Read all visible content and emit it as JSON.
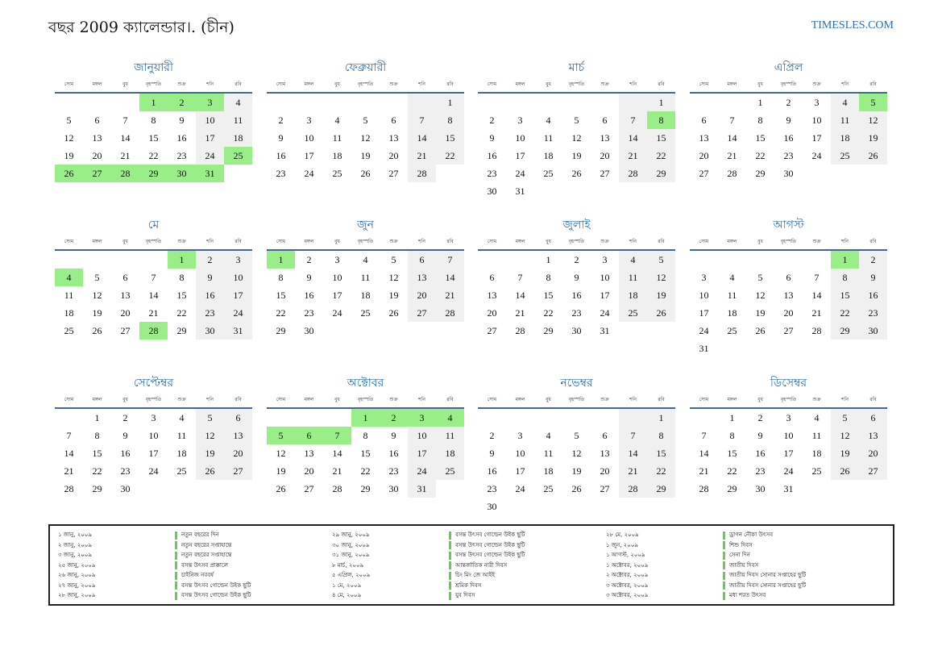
{
  "header": {
    "title": "বছর 2009 ক্যালেন্ডার।. (চীন)",
    "brand": "TIMESLES.COM"
  },
  "colors": {
    "accent": "#2a6fb0",
    "holiday": "#99ee88",
    "weekend": "#f0f0f0",
    "rule": "#44678f"
  },
  "weekdays": [
    "সোম",
    "মঙ্গল",
    "বুধ",
    "বৃহস্পতি",
    "শুক্র",
    "শনি",
    "রবি"
  ],
  "months": [
    {
      "name": "জানুয়ারী",
      "start": 3,
      "days": 31,
      "holidays": [
        1,
        2,
        3,
        25,
        26,
        27,
        28,
        29,
        30,
        31
      ]
    },
    {
      "name": "ফেব্রুয়ারী",
      "start": 6,
      "days": 28,
      "holidays": []
    },
    {
      "name": "মার্চ",
      "start": 6,
      "days": 31,
      "holidays": [
        8
      ]
    },
    {
      "name": "এপ্রিল",
      "start": 2,
      "days": 30,
      "holidays": [
        5
      ]
    },
    {
      "name": "মে",
      "start": 4,
      "days": 31,
      "holidays": [
        1,
        4,
        28
      ]
    },
    {
      "name": "জুন",
      "start": 0,
      "days": 30,
      "holidays": [
        1
      ]
    },
    {
      "name": "জুলাই",
      "start": 2,
      "days": 31,
      "holidays": []
    },
    {
      "name": "আগস্ট",
      "start": 5,
      "days": 31,
      "holidays": [
        1
      ]
    },
    {
      "name": "সেপ্টেম্বর",
      "start": 1,
      "days": 30,
      "holidays": []
    },
    {
      "name": "অক্টোবর",
      "start": 3,
      "days": 31,
      "holidays": [
        1,
        2,
        3,
        4,
        5,
        6,
        7
      ]
    },
    {
      "name": "নভেম্বর",
      "start": 6,
      "days": 30,
      "holidays": []
    },
    {
      "name": "ডিসেম্বর",
      "start": 1,
      "days": 31,
      "holidays": []
    }
  ],
  "holiday_list": [
    [
      {
        "date": "১ জানু, ২০০৯",
        "name": "নতুন বছরের দিন"
      },
      {
        "date": "২ জানু, ২০০৯",
        "name": "নতুন বছরের সপ্তাহান্তে"
      },
      {
        "date": "৩ জানু, ২০০৯",
        "name": "নতুন বছরের সপ্তাহান্তে"
      },
      {
        "date": "২৫ জানু, ২০০৯",
        "name": "বসন্ত উৎসব প্রাক্কালে"
      },
      {
        "date": "২৬ জানু, ২০০৯",
        "name": "চাইনিজ নববর্ষ"
      },
      {
        "date": "২৭ জানু, ২০০৯",
        "name": "বসন্ত উৎসব গোল্ডেন উইক ছুটি"
      },
      {
        "date": "২৮ জানু, ২০০৯",
        "name": "বসন্ত উৎসব গোল্ডেন উইক ছুটি"
      }
    ],
    [
      {
        "date": "২৯ জানু, ২০০৯",
        "name": "বসন্ত উৎসব গোল্ডেন উইক ছুটি"
      },
      {
        "date": "৩০ জানু, ২০০৯",
        "name": "বসন্ত উৎসব গোল্ডেন উইক ছুটি"
      },
      {
        "date": "৩১ জানু, ২০০৯",
        "name": "বসন্ত উৎসব গোল্ডেন উইক ছুটি"
      },
      {
        "date": "৮ মার্চ, ২০০৯",
        "name": "আন্তর্জাতিক নারী দিবস"
      },
      {
        "date": "৫ এপ্রিল, ২০০৯",
        "name": "চিং মিং জে আইই"
      },
      {
        "date": "১ মে, ২০০৯",
        "name": "শ্রমিক দিবস"
      },
      {
        "date": "৪ মে, ২০০৯",
        "name": "যুব দিবস"
      }
    ],
    [
      {
        "date": "২৮ মে, ২০০৯",
        "name": "ড্রাগন নৌকা উৎসব"
      },
      {
        "date": "১ জুন, ২০০৯",
        "name": "শিশু দিবস"
      },
      {
        "date": "১ আগস্ট, ২০০৯",
        "name": "সেনা দিন"
      },
      {
        "date": "১ অক্টোবর, ২০০৯",
        "name": "জাতীয় দিবস"
      },
      {
        "date": "২ অক্টোবর, ২০০৯",
        "name": "জাতীয় দিবস সোনার সপ্তাহের ছুটি"
      },
      {
        "date": "৩ অক্টোবর, ২০০৯",
        "name": "জাতীয় দিবস সোনার সপ্তাহের ছুটি"
      },
      {
        "date": "৩ অক্টোবর, ২০০৯",
        "name": "মধ্য শরত উৎসব"
      }
    ]
  ]
}
